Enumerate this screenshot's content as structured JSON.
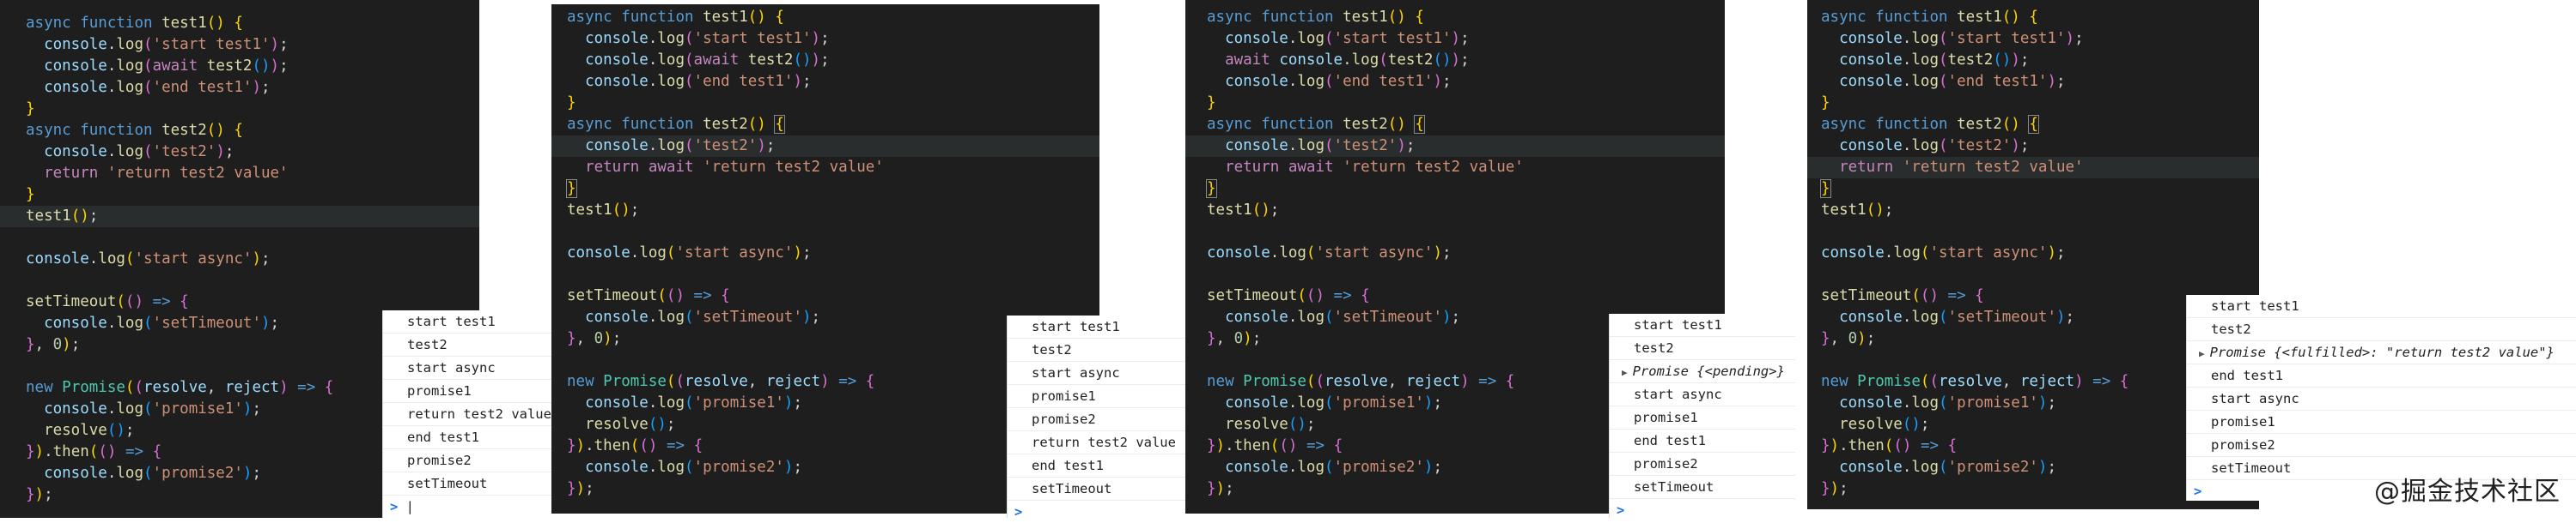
{
  "panels": [
    {
      "id": "panel-1",
      "code": [
        "async function test1() {",
        "  console.log('start test1');",
        "  console.log(await test2());",
        "  console.log('end test1');",
        "}",
        "async function test2() {",
        "  console.log('test2');",
        "  return 'return test2 value'",
        "}",
        "test1();",
        "",
        "console.log('start async');",
        "",
        "setTimeout(() => {",
        "  console.log('setTimeout');",
        "}, 0);",
        "",
        "new Promise((resolve, reject) => {",
        "  console.log('promise1');",
        "  resolve();",
        "}).then(() => {",
        "  console.log('promise2');",
        "});"
      ],
      "console": [
        "start test1",
        "test2",
        "start async",
        "promise1",
        "return test2 value",
        "end test1",
        "promise2",
        "setTimeout"
      ],
      "prompt": ">"
    },
    {
      "id": "panel-2",
      "code": [
        "async function test1() {",
        "  console.log('start test1');",
        "  console.log(await test2());",
        "  console.log('end test1');",
        "}",
        "async function test2() {",
        "  console.log('test2');",
        "  return await 'return test2 value'",
        "}",
        "test1();",
        "",
        "console.log('start async');",
        "",
        "setTimeout(() => {",
        "  console.log('setTimeout');",
        "}, 0);",
        "",
        "new Promise((resolve, reject) => {",
        "  console.log('promise1');",
        "  resolve();",
        "}).then(() => {",
        "  console.log('promise2');",
        "});"
      ],
      "console": [
        "start test1",
        "test2",
        "start async",
        "promise1",
        "promise2",
        "return test2 value",
        "end test1",
        "setTimeout"
      ],
      "prompt": ">"
    },
    {
      "id": "panel-3",
      "code": [
        "async function test1() {",
        "  console.log('start test1');",
        "  await console.log(test2());",
        "  console.log('end test1');",
        "}",
        "async function test2() {",
        "  console.log('test2');",
        "  return await 'return test2 value'",
        "}",
        "test1();",
        "",
        "console.log('start async');",
        "",
        "setTimeout(() => {",
        "  console.log('setTimeout');",
        "}, 0);",
        "",
        "new Promise((resolve, reject) => {",
        "  console.log('promise1');",
        "  resolve();",
        "}).then(() => {",
        "  console.log('promise2');",
        "});"
      ],
      "console": [
        "start test1",
        "test2",
        "Promise {<pending>}",
        "start async",
        "promise1",
        "end test1",
        "promise2",
        "setTimeout"
      ],
      "prompt": ">"
    },
    {
      "id": "panel-4",
      "code": [
        "async function test1() {",
        "  console.log('start test1');",
        "  console.log(test2());",
        "  console.log('end test1');",
        "}",
        "async function test2() {",
        "  console.log('test2');",
        "  return 'return test2 value'",
        "}",
        "test1();",
        "",
        "console.log('start async');",
        "",
        "setTimeout(() => {",
        "  console.log('setTimeout');",
        "}, 0);",
        "",
        "new Promise((resolve, reject) => {",
        "  console.log('promise1');",
        "  resolve();",
        "}).then(() => {",
        "  console.log('promise2');",
        "});"
      ],
      "console": [
        "start test1",
        "test2",
        "Promise {<fulfilled>: \"return test2 value\"}",
        "end test1",
        "start async",
        "promise1",
        "promise2",
        "setTimeout"
      ],
      "prompt": ">"
    }
  ],
  "watermark": "@掘金技术社区"
}
